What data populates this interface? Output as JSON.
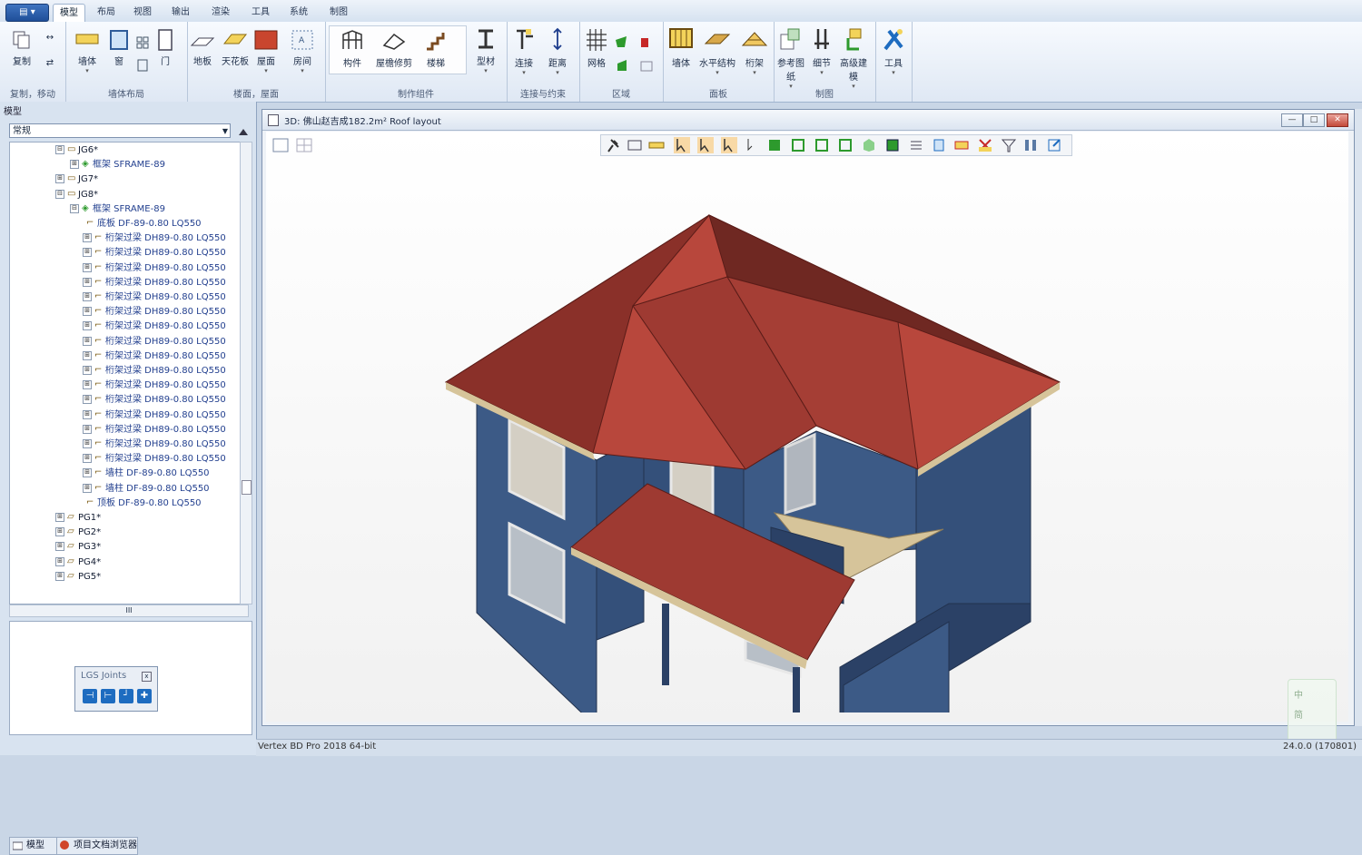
{
  "app": {
    "menu_button": "▤ ▾"
  },
  "tabs": [
    {
      "label": "模型",
      "active": true
    },
    {
      "label": "布局",
      "active": false
    },
    {
      "label": "视图",
      "active": false
    },
    {
      "label": "输出",
      "active": false
    },
    {
      "label": "渲染",
      "active": false
    },
    {
      "label": "工具",
      "active": false
    },
    {
      "label": "系统",
      "active": false
    },
    {
      "label": "制图",
      "active": false
    }
  ],
  "ribbon": {
    "groups": [
      {
        "label": "复制，移动",
        "buttons": [
          "复制",
          "↔",
          "⇄"
        ]
      },
      {
        "label": "墙体布局",
        "buttons": [
          "墙体",
          "窗",
          "门"
        ]
      },
      {
        "label": "楼面，屋面",
        "buttons": [
          "地板",
          "天花板",
          "屋面",
          "房间"
        ]
      },
      {
        "label": "制作组件",
        "buttons": [
          "构件",
          "屋檐修剪",
          "楼梯",
          "型材"
        ]
      },
      {
        "label": "连接与约束",
        "buttons": [
          "连接",
          "距离"
        ]
      },
      {
        "label": "区域",
        "buttons": [
          "网格"
        ]
      },
      {
        "label": "面板",
        "buttons": [
          "墙体",
          "水平结构",
          "桁架"
        ]
      },
      {
        "label": "制图",
        "buttons": [
          "参考图纸",
          "细节",
          "高级建模"
        ]
      },
      {
        "label": "",
        "buttons": [
          "工具"
        ]
      }
    ]
  },
  "left_panel": {
    "title": "模型",
    "dropdown_value": "常规",
    "tree": [
      {
        "indent": 50,
        "pm": "⊟",
        "icon": "▭",
        "label": "JG6*",
        "group": true
      },
      {
        "indent": 66,
        "pm": "⊞",
        "icon": "◈",
        "label": "框架 SFRAME-89",
        "green": true
      },
      {
        "indent": 50,
        "pm": "⊞",
        "icon": "▭",
        "label": "JG7*",
        "group": true
      },
      {
        "indent": 50,
        "pm": "⊟",
        "icon": "▭",
        "label": "JG8*",
        "group": true
      },
      {
        "indent": 66,
        "pm": "⊟",
        "icon": "◈",
        "label": "框架 SFRAME-89",
        "green": true
      },
      {
        "indent": 84,
        "pm": "",
        "icon": "⌐",
        "label": "底板 DF-89-0.80 LQ550"
      },
      {
        "indent": 80,
        "pm": "⊞",
        "icon": "⌐",
        "label": "桁架过梁 DH89-0.80 LQ550"
      },
      {
        "indent": 80,
        "pm": "⊞",
        "icon": "⌐",
        "label": "桁架过梁 DH89-0.80 LQ550"
      },
      {
        "indent": 80,
        "pm": "⊞",
        "icon": "⌐",
        "label": "桁架过梁 DH89-0.80 LQ550"
      },
      {
        "indent": 80,
        "pm": "⊞",
        "icon": "⌐",
        "label": "桁架过梁 DH89-0.80 LQ550"
      },
      {
        "indent": 80,
        "pm": "⊞",
        "icon": "⌐",
        "label": "桁架过梁 DH89-0.80 LQ550"
      },
      {
        "indent": 80,
        "pm": "⊞",
        "icon": "⌐",
        "label": "桁架过梁 DH89-0.80 LQ550"
      },
      {
        "indent": 80,
        "pm": "⊞",
        "icon": "⌐",
        "label": "桁架过梁 DH89-0.80 LQ550"
      },
      {
        "indent": 80,
        "pm": "⊞",
        "icon": "⌐",
        "label": "桁架过梁 DH89-0.80 LQ550"
      },
      {
        "indent": 80,
        "pm": "⊞",
        "icon": "⌐",
        "label": "桁架过梁 DH89-0.80 LQ550"
      },
      {
        "indent": 80,
        "pm": "⊞",
        "icon": "⌐",
        "label": "桁架过梁 DH89-0.80 LQ550"
      },
      {
        "indent": 80,
        "pm": "⊞",
        "icon": "⌐",
        "label": "桁架过梁 DH89-0.80 LQ550"
      },
      {
        "indent": 80,
        "pm": "⊞",
        "icon": "⌐",
        "label": "桁架过梁 DH89-0.80 LQ550"
      },
      {
        "indent": 80,
        "pm": "⊞",
        "icon": "⌐",
        "label": "桁架过梁 DH89-0.80 LQ550"
      },
      {
        "indent": 80,
        "pm": "⊞",
        "icon": "⌐",
        "label": "桁架过梁 DH89-0.80 LQ550"
      },
      {
        "indent": 80,
        "pm": "⊞",
        "icon": "⌐",
        "label": "桁架过梁 DH89-0.80 LQ550"
      },
      {
        "indent": 80,
        "pm": "⊞",
        "icon": "⌐",
        "label": "桁架过梁 DH89-0.80 LQ550"
      },
      {
        "indent": 80,
        "pm": "⊞",
        "icon": "⌐",
        "label": "墙柱 DF-89-0.80 LQ550"
      },
      {
        "indent": 80,
        "pm": "⊞",
        "icon": "⌐",
        "label": "墙柱 DF-89-0.80 LQ550"
      },
      {
        "indent": 84,
        "pm": "",
        "icon": "⌐",
        "label": "顶板 DF-89-0.80 LQ550"
      },
      {
        "indent": 50,
        "pm": "⊞",
        "icon": "▱",
        "label": "PG1*",
        "group": true
      },
      {
        "indent": 50,
        "pm": "⊞",
        "icon": "▱",
        "label": "PG2*",
        "group": true
      },
      {
        "indent": 50,
        "pm": "⊞",
        "icon": "▱",
        "label": "PG3*",
        "group": true
      },
      {
        "indent": 50,
        "pm": "⊞",
        "icon": "▱",
        "label": "PG4*",
        "group": true
      },
      {
        "indent": 50,
        "pm": "⊞",
        "icon": "▱",
        "label": "PG5*",
        "group": true
      }
    ],
    "hscroll_label": "III",
    "lgs_title": "LGS Joints",
    "lgs_close": "x",
    "bottom_tabs": [
      "模型",
      "项目文档浏览器"
    ]
  },
  "viewport": {
    "title": "3D: 佛山赵吉成182.2m²    Roof layout",
    "controls": [
      "—",
      "□",
      "✕"
    ]
  },
  "status": {
    "left": "Vertex BD Pro 2018 64-bit",
    "right": "24.0.0 (170801)"
  },
  "colors": {
    "roof_light": "#b8473c",
    "roof_mid": "#9e3a32",
    "roof_dark": "#6f2822",
    "wall_light": "#3c5a86",
    "wall_dark": "#2b4166",
    "wall_side": "#34507a",
    "fascia": "#d6c49a"
  }
}
